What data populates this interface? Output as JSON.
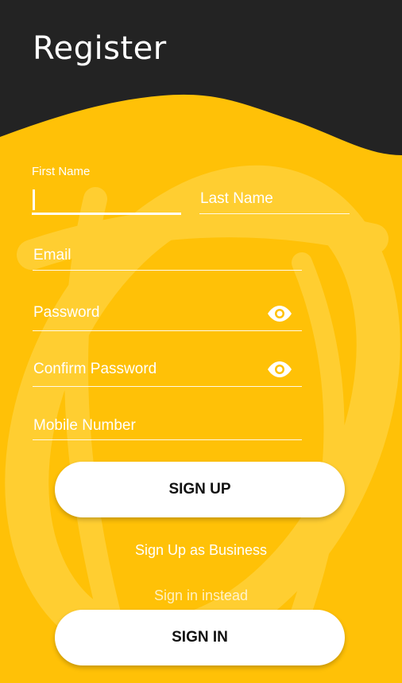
{
  "header": {
    "title": "Register"
  },
  "form": {
    "first_name_label": "First Name",
    "first_name_value": "",
    "last_name_placeholder": "Last Name",
    "email_placeholder": "Email",
    "password_placeholder": "Password",
    "confirm_password_placeholder": "Confirm Password",
    "mobile_placeholder": "Mobile Number",
    "password_toggle_icon": "eye-icon",
    "confirm_password_toggle_icon": "eye-icon"
  },
  "actions": {
    "sign_up_label": "SIGN UP",
    "business_link": "Sign Up as Business",
    "sign_in_prompt": "Sign in instead",
    "sign_in_label": "SIGN IN"
  },
  "colors": {
    "header_bg": "#232323",
    "accent": "#FFC107",
    "button_bg": "#FFFFFF",
    "text_on_accent": "#FFFFFF"
  }
}
